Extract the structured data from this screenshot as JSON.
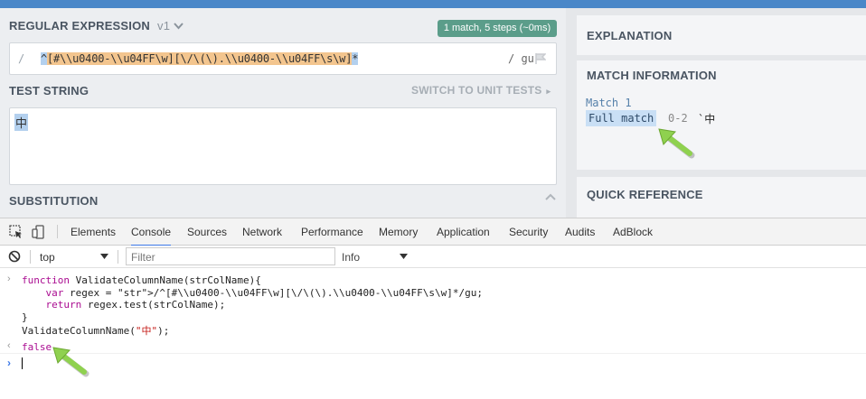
{
  "app": {
    "regex_section": {
      "title": "REGULAR EXPRESSION",
      "version": "v1",
      "match_badge": "1 match, 5 steps (~0ms)",
      "open_delim": "/",
      "pattern_parts": [
        {
          "text": "^",
          "style": "sel"
        },
        {
          "text": "[#\\\\u0400-\\\\u04FF\\w]",
          "style": "hl"
        },
        {
          "text": "[\\/\\(\\).\\\\u0400-\\\\u04FF\\s\\w]",
          "style": "hl"
        },
        {
          "text": "*",
          "style": "sel"
        }
      ],
      "flags": "/ gu"
    },
    "test_section": {
      "title": "TEST STRING",
      "switch_label": "SWITCH TO UNIT TESTS",
      "value": "中"
    },
    "substitution_section": {
      "title": "SUBSTITUTION"
    },
    "right_panel": {
      "explanation_title": "EXPLANATION",
      "match_info_title": "MATCH INFORMATION",
      "match_label": "Match 1",
      "full_match_label": "Full match",
      "range": "0-2",
      "match_value": "`中",
      "quick_ref_title": "QUICK REFERENCE"
    }
  },
  "devtools": {
    "tabs": [
      "Elements",
      "Console",
      "Sources",
      "Network",
      "Performance",
      "Memory",
      "Application",
      "Security",
      "Audits",
      "AdBlock"
    ],
    "active_tab": "Console",
    "context": "top",
    "filter_placeholder": "Filter",
    "level": "Info",
    "code_lines": [
      "function ValidateColumnName(strColName){",
      "    var regex = /^[#\\\\u0400-\\\\u04FF\\w][\\/\\(\\).\\\\u0400-\\\\u04FF\\s\\w]*/gu;",
      "    return regex.test(strColName);",
      "}",
      "ValidateColumnName(\"中\");"
    ],
    "result": "false"
  },
  "colors": {
    "accent_blue": "#4a87c8",
    "badge_green": "#5b9d8a",
    "arrow_green": "#8fd14f",
    "match_highlight": "#f3c58e"
  }
}
